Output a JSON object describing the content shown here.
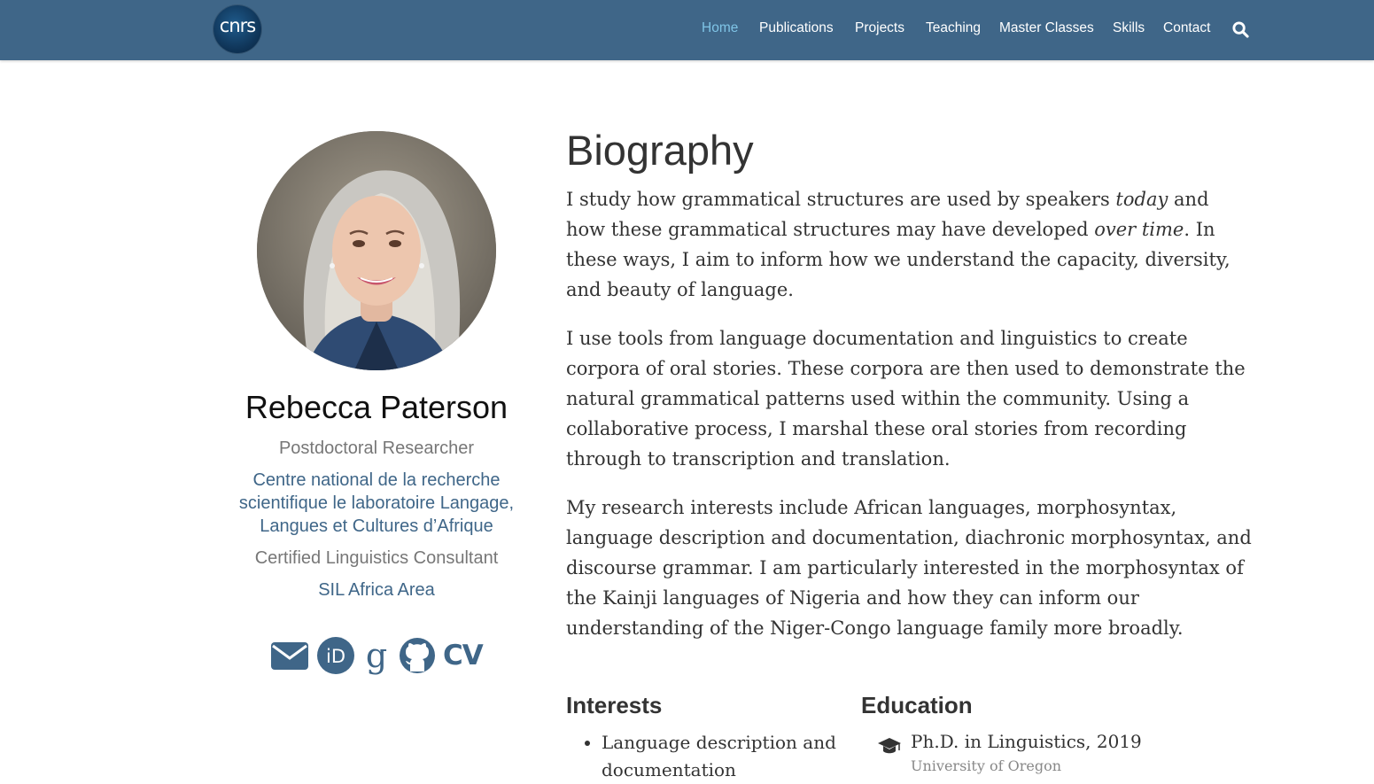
{
  "brand": {
    "logo_text": "cnrs"
  },
  "nav": {
    "items": [
      {
        "label": "Home",
        "active": true
      },
      {
        "label": "Publications",
        "active": false
      },
      {
        "label": "Projects",
        "active": false
      },
      {
        "label": "Teaching",
        "active": false
      },
      {
        "label": "Master Classes",
        "active": false
      },
      {
        "label": "Skills",
        "active": false
      },
      {
        "label": "Contact",
        "active": false
      }
    ],
    "search_icon": "search-icon"
  },
  "profile": {
    "name": "Rebecca Paterson",
    "role_1": "Postdoctoral Researcher",
    "org_1": "Centre national de la recherche scientifique le laboratoire Langage, Langues et Cultures d’Afrique",
    "role_2": "Certified Linguistics Consultant",
    "org_2": "SIL Africa Area",
    "social": [
      "envelope-icon",
      "orcid-icon",
      "google-scholar-icon",
      "github-icon",
      "cv-icon"
    ],
    "social_cv_label": "CV"
  },
  "biography": {
    "title": "Biography",
    "p1_a": "I study how grammatical structures are used by speakers ",
    "p1_em1": "today",
    "p1_b": " and how these grammatical structures may have developed ",
    "p1_em2": "over time",
    "p1_c": ". In these ways, I aim to inform how we understand the capacity, diversity, and beauty of language.",
    "p2": "I use tools from language documentation and linguistics to create corpora of oral stories. These corpora are then used to demonstrate the natural grammatical patterns used within the community. Using a collaborative process, I marshal these oral stories from recording through to transcription and translation.",
    "p3": "My research interests include African languages, morphosyntax, language description and documentation, diachronic morphosyntax, and discourse grammar. I am particularly interested in the morphosyntax of the Kainji languages of Nigeria and how they can inform our understanding of the Niger-Congo language family more broadly."
  },
  "interests": {
    "title": "Interests",
    "items": [
      "Language description and documentation"
    ]
  },
  "education": {
    "title": "Education",
    "items": [
      {
        "degree": "Ph.D. in Linguistics, 2019",
        "school": "University of Oregon"
      }
    ]
  },
  "colors": {
    "navbar": "#3f6688",
    "nav_active": "#7fc4e6",
    "accent": "#3f6688"
  }
}
